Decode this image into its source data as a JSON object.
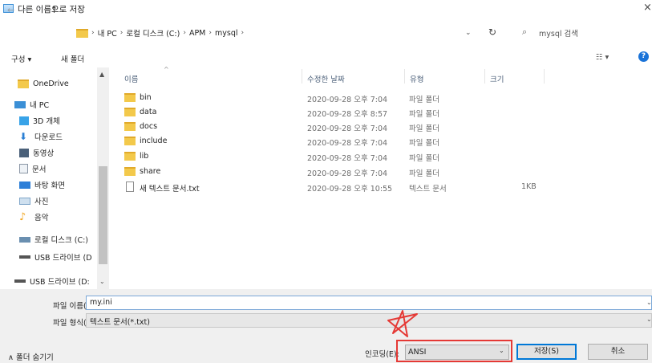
{
  "window": {
    "title": "다른 이름으로 저장",
    "close": "×"
  },
  "nav": {
    "back": "←",
    "forward": "→",
    "recent": "⌄",
    "up": "↑",
    "breadcrumb": [
      "내 PC",
      "로컬 디스크 (C:)",
      "APM",
      "mysql"
    ],
    "refresh": "↻",
    "search_placeholder": "mysql 검색"
  },
  "toolbar": {
    "organize": "구성 ▾",
    "new_folder": "새 폴더",
    "view": "☷ ▾",
    "help": "?"
  },
  "sidebar": {
    "items": [
      {
        "label": "OneDrive",
        "icon": "folder-icon",
        "color": "#f3c94b"
      },
      {
        "label": "내 PC",
        "icon": "computer-icon",
        "color": "#3b8fd6"
      },
      {
        "label": "3D 개체",
        "icon": "cube-icon",
        "color": "#38a3e8"
      },
      {
        "label": "다운로드",
        "icon": "download-icon",
        "color": "#2b7fd4"
      },
      {
        "label": "동영상",
        "icon": "video-icon",
        "color": "#4a6079"
      },
      {
        "label": "문서",
        "icon": "document-icon",
        "color": "#8a96a5"
      },
      {
        "label": "바탕 화면",
        "icon": "desktop-icon",
        "color": "#2d7fd8"
      },
      {
        "label": "사진",
        "icon": "picture-icon",
        "color": "#7fa6c9"
      },
      {
        "label": "음악",
        "icon": "music-icon",
        "color": "#f1a51f"
      },
      {
        "label": "로컬 디스크 (C:)",
        "icon": "drive-icon",
        "color": "#6a8fb0"
      },
      {
        "label": "USB 드라이브 (D",
        "icon": "usb-drive-icon",
        "color": "#555555"
      },
      {
        "label": "USB 드라이브 (D:",
        "icon": "usb-drive-icon",
        "color": "#555555"
      }
    ]
  },
  "columns": {
    "name": "이름",
    "date": "수정한 날짜",
    "type": "유형",
    "size": "크기"
  },
  "files": [
    {
      "name": "bin",
      "date": "2020-09-28 오후 7:04",
      "type": "파일 폴더",
      "size": "",
      "kind": "folder"
    },
    {
      "name": "data",
      "date": "2020-09-28 오후 8:57",
      "type": "파일 폴더",
      "size": "",
      "kind": "folder"
    },
    {
      "name": "docs",
      "date": "2020-09-28 오후 7:04",
      "type": "파일 폴더",
      "size": "",
      "kind": "folder"
    },
    {
      "name": "include",
      "date": "2020-09-28 오후 7:04",
      "type": "파일 폴더",
      "size": "",
      "kind": "folder"
    },
    {
      "name": "lib",
      "date": "2020-09-28 오후 7:04",
      "type": "파일 폴더",
      "size": "",
      "kind": "folder"
    },
    {
      "name": "share",
      "date": "2020-09-28 오후 7:04",
      "type": "파일 폴더",
      "size": "",
      "kind": "folder"
    },
    {
      "name": "새 텍스트 문서.txt",
      "date": "2020-09-28 오후 10:55",
      "type": "텍스트 문서",
      "size": "1KB",
      "kind": "txt"
    }
  ],
  "footer": {
    "filename_label": "파일 이름(N):",
    "filename_value": "my.ini",
    "filetype_label": "파일 형식(T):",
    "filetype_value": "텍스트 문서(*.txt)",
    "hide_folders": "∧ 폴더 숨기기",
    "encoding_label": "인코딩(E):",
    "encoding_value": "ANSI",
    "save": "저장(S)",
    "cancel": "취소"
  },
  "colors": {
    "highlight": "#e53935",
    "selection": "#cce8ff",
    "accent": "#0078d7"
  }
}
